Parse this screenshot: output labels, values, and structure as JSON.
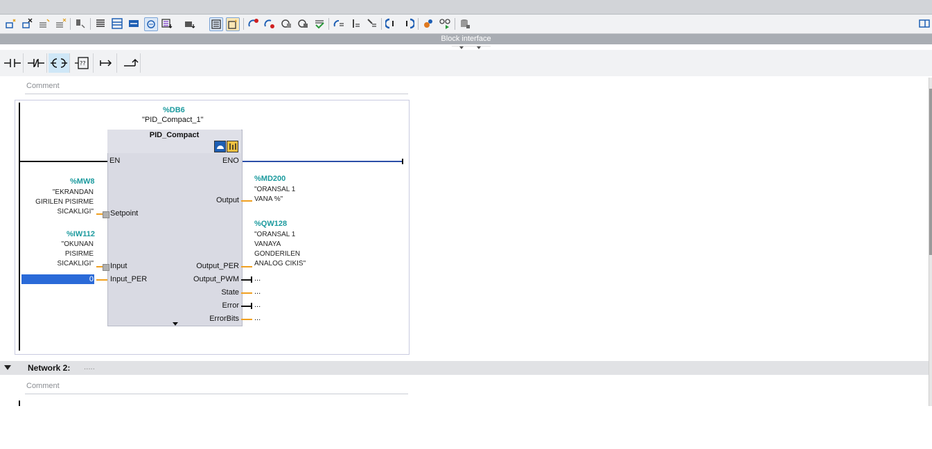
{
  "header": {
    "block_interface_label": "Block interface"
  },
  "toolbar": {
    "icons": [
      "insert-network-icon",
      "delete-network-icon",
      "insert-row-icon",
      "add-row-icon",
      "clear-icon",
      "open-all-networks-icon",
      "close-all-networks-icon",
      "show-favorites-icon",
      "show-comments-icon",
      "absolute-operands-icon",
      "operand-display-icon",
      "symbolic-operands-icon",
      "show-tags-info-icon",
      "delete-breakpoint-icon",
      "reset-breakpoint-icon",
      "save-monitor-icon",
      "load-monitor-icon",
      "compile-check-icon",
      "monitor-on-icon",
      "step-icon",
      "step-into-icon",
      "go-to-previous-error-icon",
      "go-to-next-error-icon",
      "settings-icon",
      "simulate-icon",
      "block-db-icon",
      "right-panel-icon"
    ]
  },
  "ladder_toolbar": {
    "items": [
      "no-contact-icon",
      "nc-contact-icon",
      "coil-icon",
      "empty-box-icon",
      "open-branch-icon",
      "close-branch-icon"
    ]
  },
  "network1": {
    "comment_placeholder": "Comment",
    "instance_db_address": "%DB6",
    "instance_db_name": "\"PID_Compact_1\"",
    "block_name": "PID_Compact",
    "inputs": {
      "en": "EN",
      "setpoint": {
        "label": "Setpoint",
        "address": "%MW8",
        "symbol": [
          "\"EKRANDAN",
          "GIRILEN PISIRME",
          "SICAKLIGI\""
        ]
      },
      "input": {
        "label": "Input",
        "address": "%IW112",
        "symbol": [
          "\"OKUNAN",
          "PISIRME",
          "SICAKLIGI\""
        ]
      },
      "input_per": {
        "label": "Input_PER",
        "value": "0"
      }
    },
    "outputs": {
      "eno": "ENO",
      "output": {
        "label": "Output",
        "address": "%MD200",
        "symbol": [
          "\"ORANSAL 1",
          "VANA %\""
        ]
      },
      "output_per": {
        "label": "Output_PER",
        "address": "%QW128",
        "symbol": [
          "\"ORANSAL 1",
          "VANAYA",
          "GONDERILEN",
          "ANALOG CIKIS\""
        ]
      },
      "output_pwm": {
        "label": "Output_PWM",
        "value": "..."
      },
      "state": {
        "label": "State",
        "value": "..."
      },
      "error": {
        "label": "Error",
        "value": "..."
      },
      "errorbits": {
        "label": "ErrorBits",
        "value": "..."
      }
    }
  },
  "network2": {
    "title": "Network 2:",
    "title_extra": ".....",
    "comment_placeholder": "Comment"
  },
  "colors": {
    "accent_teal": "#1b9a9e",
    "wire_orange": "#f0a020",
    "selection_blue": "#2a6ad8",
    "header_gray": "#a9adb3"
  }
}
